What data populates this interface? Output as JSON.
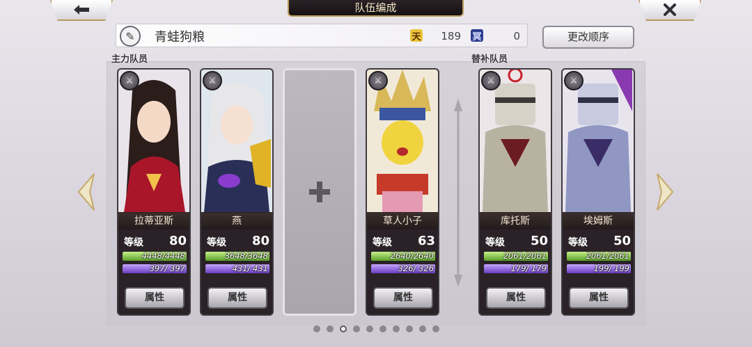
{
  "header": {
    "title": "队伍编成",
    "back_icon": "arrow-left-icon",
    "close_icon": "close-icon"
  },
  "team": {
    "name": "青蛙狗粮",
    "resources": [
      {
        "icon": "heaven-icon",
        "glyph": "天",
        "value": "189"
      },
      {
        "icon": "hell-icon",
        "glyph": "冥",
        "value": "0"
      }
    ],
    "order_button": "更改顺序"
  },
  "sections": {
    "main": "主力队员",
    "sub": "替补队员"
  },
  "cards": [
    {
      "name": "拉蒂亚斯",
      "level_label": "等级",
      "level": "80",
      "hp": "4448/4448",
      "mp": "397/ 397",
      "attr": "属性"
    },
    {
      "name": "燕",
      "level_label": "等级",
      "level": "80",
      "hp": "3648/3648",
      "mp": "431/ 431",
      "attr": "属性"
    },
    {
      "name": "草人小子",
      "level_label": "等级",
      "level": "63",
      "hp": "2640/2640",
      "mp": "326/ 326",
      "attr": "属性"
    },
    {
      "name": "库托斯",
      "level_label": "等级",
      "level": "50",
      "hp": "2061/2061",
      "mp": "179/ 179",
      "attr": "属性"
    },
    {
      "name": "埃姆斯",
      "level_label": "等级",
      "level": "50",
      "hp": "2061/2061",
      "mp": "199/ 199",
      "attr": "属性"
    }
  ],
  "pager": {
    "total": 10,
    "active": 2
  }
}
